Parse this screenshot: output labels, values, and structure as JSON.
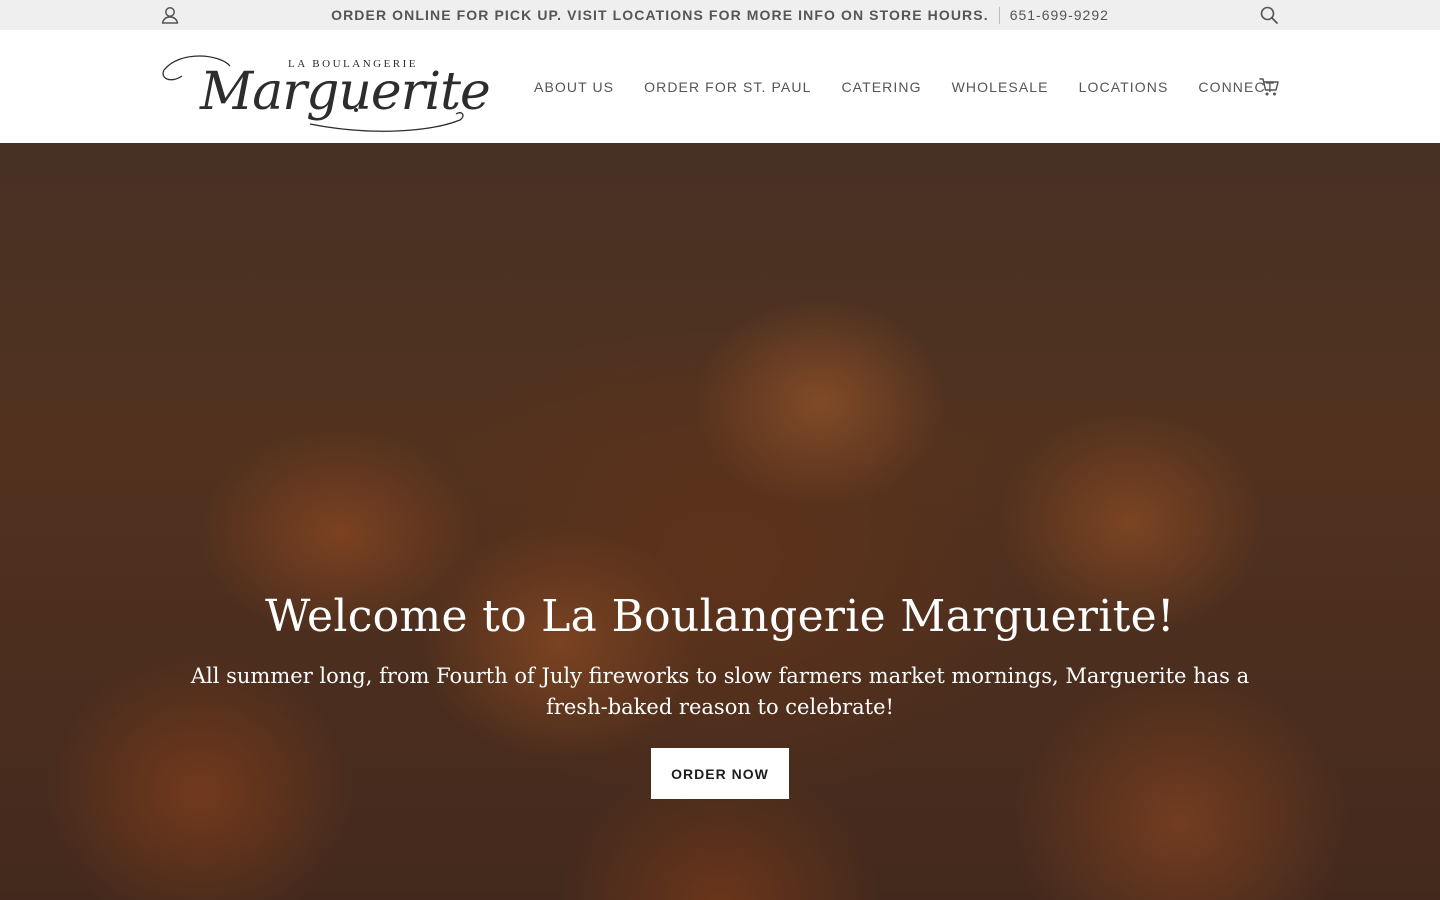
{
  "announcement": {
    "message": "ORDER ONLINE FOR PICK UP. VISIT LOCATIONS FOR MORE INFO ON STORE HOURS.",
    "phone": "651-699-9292"
  },
  "icons": {
    "account": "user-icon",
    "search": "search-icon",
    "cart": "cart-icon"
  },
  "logo": {
    "small_text": "LA BOULANGERIE",
    "script_text": "Marguerite"
  },
  "nav": {
    "items": [
      {
        "label": "ABOUT US"
      },
      {
        "label": "ORDER FOR ST. PAUL"
      },
      {
        "label": "CATERING"
      },
      {
        "label": "WHOLESALE"
      },
      {
        "label": "LOCATIONS"
      },
      {
        "label": "CONNECT"
      }
    ]
  },
  "hero": {
    "title": "Welcome to La Boulangerie Marguerite!",
    "subtitle": "All summer long, from Fourth of July fireworks to slow farmers market mornings, Marguerite has a fresh-baked reason to celebrate!",
    "button_label": "ORDER NOW"
  },
  "colors": {
    "topbar_bg": "#efefef",
    "text": "#555555",
    "hero_text": "#ffffff",
    "button_bg": "#ffffff"
  }
}
